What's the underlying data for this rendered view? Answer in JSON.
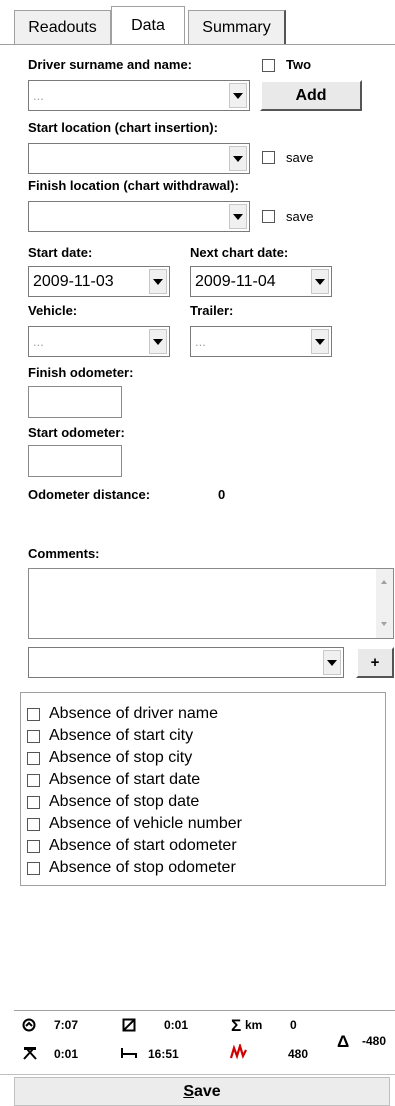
{
  "tabs": [
    "Readouts",
    "Data",
    "Summary"
  ],
  "active_tab": "Data",
  "driver": {
    "label": "Driver surname and name:",
    "two_label": "Two",
    "value": "...",
    "add_label": "Add"
  },
  "start_location": {
    "label": "Start location (chart insertion):",
    "value": "",
    "save_label": "save"
  },
  "finish_location": {
    "label": "Finish location (chart withdrawal):",
    "value": "",
    "save_label": "save"
  },
  "start_date": {
    "label": "Start date:",
    "value": "2009-11-03"
  },
  "next_chart_date": {
    "label": "Next chart date:",
    "value": "2009-11-04"
  },
  "vehicle": {
    "label": "Vehicle:",
    "value": "..."
  },
  "trailer": {
    "label": "Trailer:",
    "value": "..."
  },
  "finish_odometer": {
    "label": "Finish odometer:",
    "value": ""
  },
  "start_odometer": {
    "label": "Start odometer:",
    "value": ""
  },
  "odometer_distance": {
    "label": "Odometer distance:",
    "value": "0"
  },
  "comments": {
    "label": "Comments:",
    "value": "",
    "add_label": "+"
  },
  "absence_checks": [
    "Absence of driver name",
    "Absence of start city",
    "Absence of stop city",
    "Absence of start date",
    "Absence of stop date",
    "Absence of vehicle number",
    "Absence of start odometer",
    "Absence of stop odometer"
  ],
  "status": {
    "drive_time": "7:07",
    "work_time": "0:01",
    "rest_time": "0:01",
    "break_time": "16:51",
    "sum_km_label": "km",
    "sum_km": "0",
    "speed_val": "480",
    "delta_val": "-480"
  },
  "save_label": "Save"
}
